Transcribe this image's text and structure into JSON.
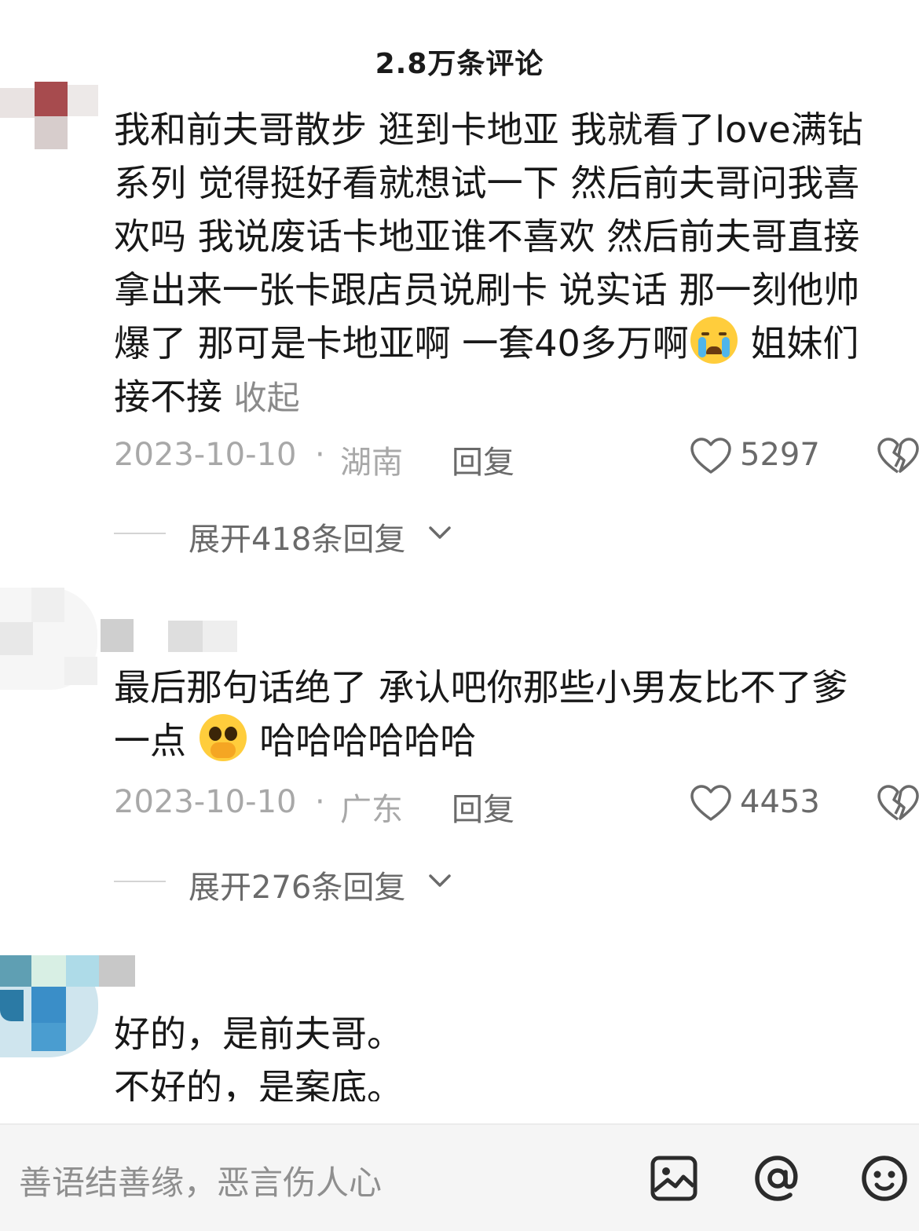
{
  "header": {
    "title": "2.8万条评论"
  },
  "comments": [
    {
      "lines": [
        "我和前夫哥散步 逛到卡地亚 我就看了love满钻",
        "系列 觉得挺好看就想试一下 然后前夫哥问我喜",
        "欢吗 我说废话卡地亚谁不喜欢 然后前夫哥直接",
        "拿出来一张卡跟店员说刷卡 说实话 那一刻他帅",
        "爆了 那可是卡地亚啊 一套40多万啊",
        " 姐妹们",
        "接不接"
      ],
      "collapse_label": "收起",
      "emoji": "loudly-crying-face",
      "date": "2023-10-10",
      "separator": "·",
      "location": "湖南",
      "reply_label": "回复",
      "likes": "5297",
      "expand_label": "展开418条回复"
    },
    {
      "lines": [
        "最后那句话绝了 承认吧你那些小男友比不了爹",
        "一点",
        "哈哈哈哈哈哈"
      ],
      "emoji": "face-holding-back-tears",
      "date": "2023-10-10",
      "separator": "·",
      "location": "广东",
      "reply_label": "回复",
      "likes": "4453",
      "expand_label": "展开276条回复"
    },
    {
      "lines": [
        "好的，是前夫哥。",
        "不好的，是案底。"
      ]
    }
  ],
  "input_bar": {
    "placeholder": "善语结善缘，恶言伤人心",
    "icons": [
      "image-icon",
      "at-mention-icon",
      "emoji-icon"
    ]
  },
  "colors": {
    "text_primary": "#181818",
    "text_secondary": "#a8a8a8",
    "text_action": "#6a6a6a",
    "input_bg": "#f5f5f5",
    "emoji_yellow": "#ffcd3c"
  }
}
